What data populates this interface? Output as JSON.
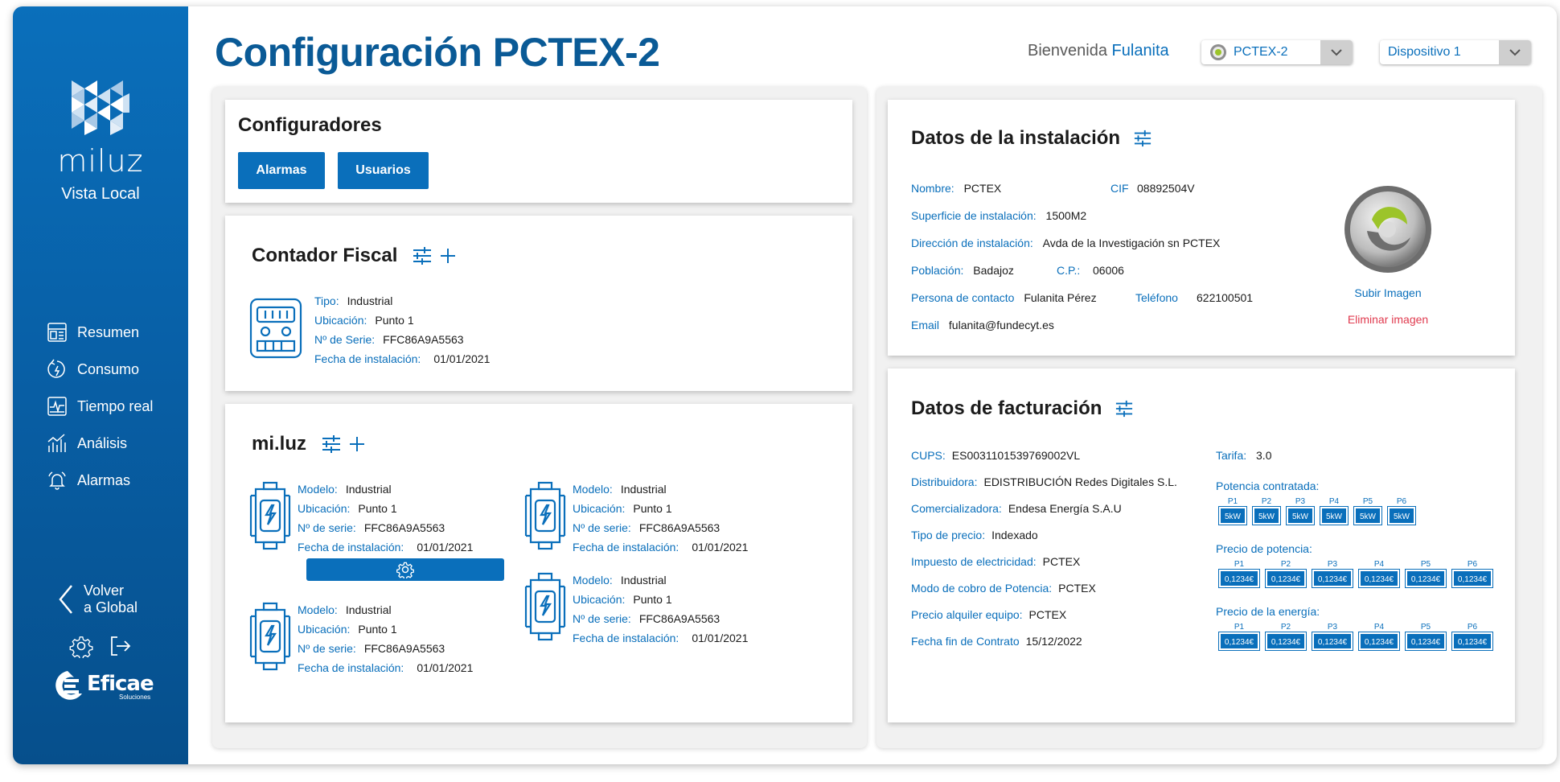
{
  "sidebar": {
    "brand": "miluz",
    "subtitle": "Vista Local",
    "nav": [
      {
        "label": "Resumen",
        "icon": "dashboard-icon"
      },
      {
        "label": "Consumo",
        "icon": "consumption-icon"
      },
      {
        "label": "Tiempo real",
        "icon": "realtime-icon"
      },
      {
        "label": "Análisis",
        "icon": "analysis-chart-icon"
      },
      {
        "label": "Alarmas",
        "icon": "alarm-bell-icon"
      }
    ],
    "back_line1": "Volver",
    "back_line2": "a Global",
    "company": "Eficae",
    "company_sub": "Soluciones"
  },
  "header": {
    "title": "Configuración PCTEX-2",
    "welcome": "Bienvenida",
    "user": "Fulanita",
    "installation_select": "PCTEX-2",
    "device_select": "Dispositivo 1"
  },
  "configuradores": {
    "title": "Configuradores",
    "buttons": [
      "Alarmas",
      "Usuarios"
    ]
  },
  "contador": {
    "title": "Contador Fiscal",
    "tipo_label": "Tipo:",
    "tipo": "Industrial",
    "ubicacion_label": "Ubicación:",
    "ubicacion": "Punto 1",
    "serie_label": "Nº de Serie:",
    "serie": "FFC86A9A5563",
    "fecha_label": "Fecha de instalación:",
    "fecha": "01/01/2021"
  },
  "miluz": {
    "title": "mi.luz",
    "labels": {
      "modelo": "Modelo:",
      "ubicacion": "Ubicación:",
      "serie": "Nº de serie:",
      "fecha": "Fecha de instalación:"
    },
    "devices": [
      {
        "modelo": "Industrial",
        "ubicacion": "Punto 1",
        "serie": "FFC86A9A5563",
        "fecha": "01/01/2021"
      },
      {
        "modelo": "Industrial",
        "ubicacion": "Punto 1",
        "serie": "FFC86A9A5563",
        "fecha": "01/01/2021"
      },
      {
        "modelo": "Industrial",
        "ubicacion": "Punto 1",
        "serie": "FFC86A9A5563",
        "fecha": "01/01/2021"
      },
      {
        "modelo": "Industrial",
        "ubicacion": "Punto 1",
        "serie": "FFC86A9A5563",
        "fecha": "01/01/2021"
      }
    ]
  },
  "instalacion": {
    "title": "Datos de la instalación",
    "nombre_label": "Nombre:",
    "nombre": "PCTEX",
    "cif_label": "CIF",
    "cif": "08892504V",
    "superficie_label": "Superficie de instalación:",
    "superficie": "1500M2",
    "direccion_label": "Dirección de instalación:",
    "direccion": "Avda de la Investigación sn PCTEX",
    "poblacion_label": "Población:",
    "poblacion": "Badajoz",
    "cp_label": "C.P.:",
    "cp": "06006",
    "contacto_label": "Persona de contacto",
    "contacto": "Fulanita Pérez",
    "telefono_label": "Teléfono",
    "telefono": "622100501",
    "email_label": "Email",
    "email": "fulanita@fundecyt.es",
    "upload": "Subir Imagen",
    "delete": "Eliminar imagen",
    "delete_color": "#e03a4e"
  },
  "facturacion": {
    "title": "Datos de facturación",
    "cups_label": "CUPS:",
    "cups": "ES0031101539769002VL",
    "distribuidora_label": "Distribuidora:",
    "distribuidora": "EDISTRIBUCIÓN Redes Digitales S.L.",
    "comercializadora_label": "Comercializadora:",
    "comercializadora": "Endesa Energía S.A.U",
    "tipo_precio_label": "Tipo de precio:",
    "tipo_precio": "Indexado",
    "impuesto_label": "Impuesto de electricidad:",
    "impuesto": "PCTEX",
    "modo_label": "Modo de cobro de Potencia:",
    "modo": "PCTEX",
    "alquiler_label": "Precio alquiler equipo:",
    "alquiler": "PCTEX",
    "fin_label": "Fecha fin de Contrato",
    "fin": "15/12/2022",
    "tarifa_label": "Tarifa:",
    "tarifa": "3.0",
    "potencia_title": "Potencia contratada:",
    "precio_potencia_title": "Precio de potencia:",
    "precio_energia_title": "Precio de la energía:",
    "periods": [
      "P1",
      "P2",
      "P3",
      "P4",
      "P5",
      "P6"
    ],
    "potencia": [
      "5kW",
      "5kW",
      "5kW",
      "5kW",
      "5kW",
      "5kW"
    ],
    "precio_potencia": [
      "0,1234€",
      "0,1234€",
      "0,1234€",
      "0,1234€",
      "0,1234€",
      "0,1234€"
    ],
    "precio_energia": [
      "0,1234€",
      "0,1234€",
      "0,1234€",
      "0,1234€",
      "0,1234€",
      "0,1234€"
    ]
  },
  "colors": {
    "primary": "#0a6fbb",
    "title": "#0a5a96"
  }
}
